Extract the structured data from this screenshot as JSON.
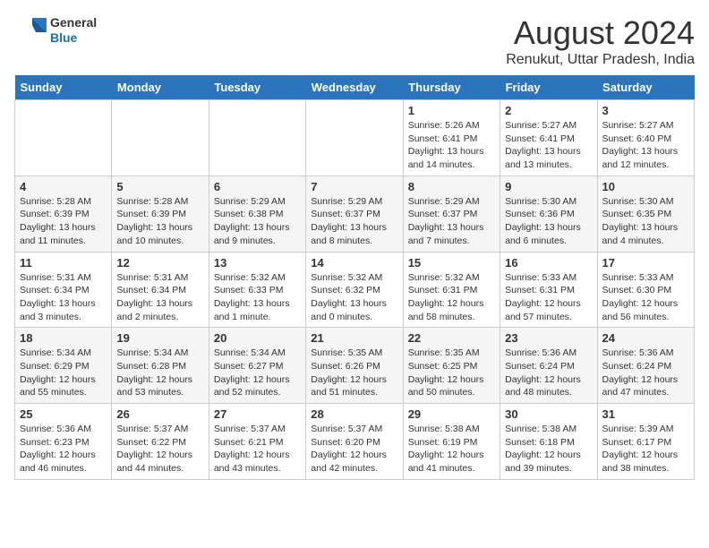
{
  "header": {
    "logo_general": "General",
    "logo_blue": "Blue",
    "title": "August 2024",
    "subtitle": "Renukut, Uttar Pradesh, India"
  },
  "calendar": {
    "days": [
      "Sunday",
      "Monday",
      "Tuesday",
      "Wednesday",
      "Thursday",
      "Friday",
      "Saturday"
    ],
    "weeks": [
      [
        {
          "date": "",
          "text": ""
        },
        {
          "date": "",
          "text": ""
        },
        {
          "date": "",
          "text": ""
        },
        {
          "date": "",
          "text": ""
        },
        {
          "date": "1",
          "text": "Sunrise: 5:26 AM\nSunset: 6:41 PM\nDaylight: 13 hours\nand 14 minutes."
        },
        {
          "date": "2",
          "text": "Sunrise: 5:27 AM\nSunset: 6:41 PM\nDaylight: 13 hours\nand 13 minutes."
        },
        {
          "date": "3",
          "text": "Sunrise: 5:27 AM\nSunset: 6:40 PM\nDaylight: 13 hours\nand 12 minutes."
        }
      ],
      [
        {
          "date": "4",
          "text": "Sunrise: 5:28 AM\nSunset: 6:39 PM\nDaylight: 13 hours\nand 11 minutes."
        },
        {
          "date": "5",
          "text": "Sunrise: 5:28 AM\nSunset: 6:39 PM\nDaylight: 13 hours\nand 10 minutes."
        },
        {
          "date": "6",
          "text": "Sunrise: 5:29 AM\nSunset: 6:38 PM\nDaylight: 13 hours\nand 9 minutes."
        },
        {
          "date": "7",
          "text": "Sunrise: 5:29 AM\nSunset: 6:37 PM\nDaylight: 13 hours\nand 8 minutes."
        },
        {
          "date": "8",
          "text": "Sunrise: 5:29 AM\nSunset: 6:37 PM\nDaylight: 13 hours\nand 7 minutes."
        },
        {
          "date": "9",
          "text": "Sunrise: 5:30 AM\nSunset: 6:36 PM\nDaylight: 13 hours\nand 6 minutes."
        },
        {
          "date": "10",
          "text": "Sunrise: 5:30 AM\nSunset: 6:35 PM\nDaylight: 13 hours\nand 4 minutes."
        }
      ],
      [
        {
          "date": "11",
          "text": "Sunrise: 5:31 AM\nSunset: 6:34 PM\nDaylight: 13 hours\nand 3 minutes."
        },
        {
          "date": "12",
          "text": "Sunrise: 5:31 AM\nSunset: 6:34 PM\nDaylight: 13 hours\nand 2 minutes."
        },
        {
          "date": "13",
          "text": "Sunrise: 5:32 AM\nSunset: 6:33 PM\nDaylight: 13 hours\nand 1 minute."
        },
        {
          "date": "14",
          "text": "Sunrise: 5:32 AM\nSunset: 6:32 PM\nDaylight: 13 hours\nand 0 minutes."
        },
        {
          "date": "15",
          "text": "Sunrise: 5:32 AM\nSunset: 6:31 PM\nDaylight: 12 hours\nand 58 minutes."
        },
        {
          "date": "16",
          "text": "Sunrise: 5:33 AM\nSunset: 6:31 PM\nDaylight: 12 hours\nand 57 minutes."
        },
        {
          "date": "17",
          "text": "Sunrise: 5:33 AM\nSunset: 6:30 PM\nDaylight: 12 hours\nand 56 minutes."
        }
      ],
      [
        {
          "date": "18",
          "text": "Sunrise: 5:34 AM\nSunset: 6:29 PM\nDaylight: 12 hours\nand 55 minutes."
        },
        {
          "date": "19",
          "text": "Sunrise: 5:34 AM\nSunset: 6:28 PM\nDaylight: 12 hours\nand 53 minutes."
        },
        {
          "date": "20",
          "text": "Sunrise: 5:34 AM\nSunset: 6:27 PM\nDaylight: 12 hours\nand 52 minutes."
        },
        {
          "date": "21",
          "text": "Sunrise: 5:35 AM\nSunset: 6:26 PM\nDaylight: 12 hours\nand 51 minutes."
        },
        {
          "date": "22",
          "text": "Sunrise: 5:35 AM\nSunset: 6:25 PM\nDaylight: 12 hours\nand 50 minutes."
        },
        {
          "date": "23",
          "text": "Sunrise: 5:36 AM\nSunset: 6:24 PM\nDaylight: 12 hours\nand 48 minutes."
        },
        {
          "date": "24",
          "text": "Sunrise: 5:36 AM\nSunset: 6:24 PM\nDaylight: 12 hours\nand 47 minutes."
        }
      ],
      [
        {
          "date": "25",
          "text": "Sunrise: 5:36 AM\nSunset: 6:23 PM\nDaylight: 12 hours\nand 46 minutes."
        },
        {
          "date": "26",
          "text": "Sunrise: 5:37 AM\nSunset: 6:22 PM\nDaylight: 12 hours\nand 44 minutes."
        },
        {
          "date": "27",
          "text": "Sunrise: 5:37 AM\nSunset: 6:21 PM\nDaylight: 12 hours\nand 43 minutes."
        },
        {
          "date": "28",
          "text": "Sunrise: 5:37 AM\nSunset: 6:20 PM\nDaylight: 12 hours\nand 42 minutes."
        },
        {
          "date": "29",
          "text": "Sunrise: 5:38 AM\nSunset: 6:19 PM\nDaylight: 12 hours\nand 41 minutes."
        },
        {
          "date": "30",
          "text": "Sunrise: 5:38 AM\nSunset: 6:18 PM\nDaylight: 12 hours\nand 39 minutes."
        },
        {
          "date": "31",
          "text": "Sunrise: 5:39 AM\nSunset: 6:17 PM\nDaylight: 12 hours\nand 38 minutes."
        }
      ]
    ]
  }
}
